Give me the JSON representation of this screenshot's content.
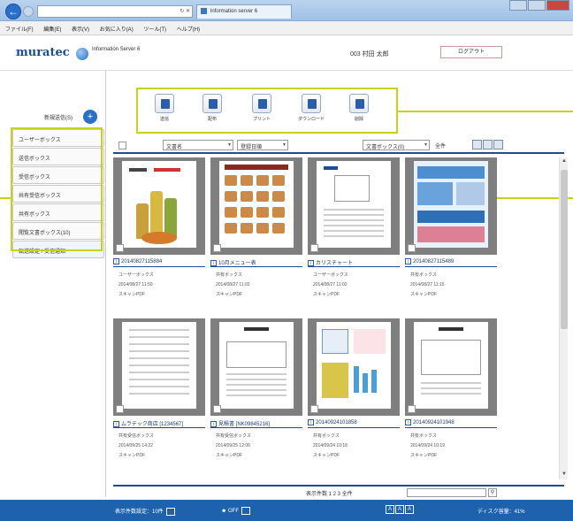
{
  "browser": {
    "tab_label": "Information server 6",
    "menu": [
      "ファイル(F)",
      "編集(E)",
      "表示(V)",
      "お気に入り(A)",
      "ツール(T)",
      "ヘルプ(H)"
    ]
  },
  "app": {
    "logo": "muratec",
    "product_label": "Information Server 6",
    "user": "003 村田 太郎",
    "logout_label": "ログアウト"
  },
  "sidebar": {
    "new_send": "新規送信(S)",
    "boxes": [
      "ユーザーボックス",
      "送信ボックス",
      "受信ボックス",
      "共有受信ボックス",
      "共有ボックス",
      "閲覧文書ボックス(10)",
      "転送設定 / 受信通知"
    ]
  },
  "toolbar": {
    "buttons": [
      "送信",
      "配布",
      "プリント",
      "ダウンロード",
      "削除"
    ]
  },
  "filter": {
    "sort_field": "文書名",
    "sort_order": "登録日順",
    "box_filter": "文書ボックス(0)",
    "count_label": "全件"
  },
  "documents": [
    {
      "title": "20140827115884",
      "box": "ユーザーボックス",
      "date": "2014/08/27 11:50",
      "type": "スキャンPDF"
    },
    {
      "title": "10月メニュー表",
      "box": "共有ボックス",
      "date": "2014/08/27 11:02",
      "type": "スキャンPDF"
    },
    {
      "title": "カリスチャート",
      "box": "ユーザーボックス",
      "date": "2014/08/27 11:02",
      "type": "スキャンPDF"
    },
    {
      "title": "20140827115489",
      "box": "共有ボックス",
      "date": "2014/08/27 11:15",
      "type": "スキャンPDF"
    },
    {
      "title": "ムラテック商店 [1234567]",
      "box": "共有受信ボックス",
      "date": "2014/09/25 14:22",
      "type": "スキャンPDF"
    },
    {
      "title": "見積書 [NK09845216]",
      "box": "共有受信ボックス",
      "date": "2014/09/25 12:06",
      "type": "スキャンPDF"
    },
    {
      "title": "20140924101858",
      "box": "共有ボックス",
      "date": "2014/09/24 10:18",
      "type": "スキャンPDF"
    },
    {
      "title": "20140924101948",
      "box": "共有ボックス",
      "date": "2014/09/24 10:19",
      "type": "スキャンPDF"
    }
  ],
  "pager": {
    "label": "表示件数 1 2 3 全件"
  },
  "statusbar": {
    "left": "表示件数設定：10件",
    "middle": "OFF",
    "zoom_buttons": [
      "A",
      "A",
      "A"
    ],
    "right": "ディスク容量：41%"
  },
  "colors": {
    "accent": "#1e4f96",
    "highlight": "#c8d21e",
    "status_bg": "#1e62ad"
  }
}
